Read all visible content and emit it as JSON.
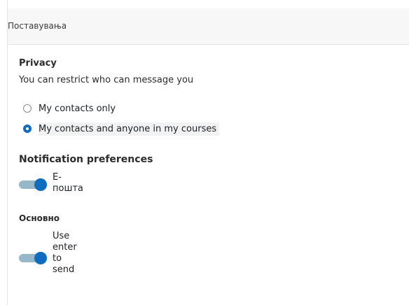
{
  "header": {
    "title": "Поставувања"
  },
  "privacy": {
    "title": "Privacy",
    "description": "You can restrict who can message you",
    "options": [
      {
        "label": "My contacts only",
        "selected": false
      },
      {
        "label": "My contacts and anyone in my courses",
        "selected": true
      }
    ]
  },
  "notification_preferences": {
    "title": "Notification preferences",
    "email": {
      "label_line1": "Е-",
      "label_line2": "пошта",
      "enabled": true
    }
  },
  "general": {
    "title": "Основно",
    "enter_to_send": {
      "label_lines": [
        "Use",
        "enter",
        "to",
        "send"
      ],
      "enabled": true
    }
  },
  "colors": {
    "accent": "#0f6cbf",
    "toggle_track": "#97b8c8",
    "header_bg": "#f7f7f7"
  }
}
